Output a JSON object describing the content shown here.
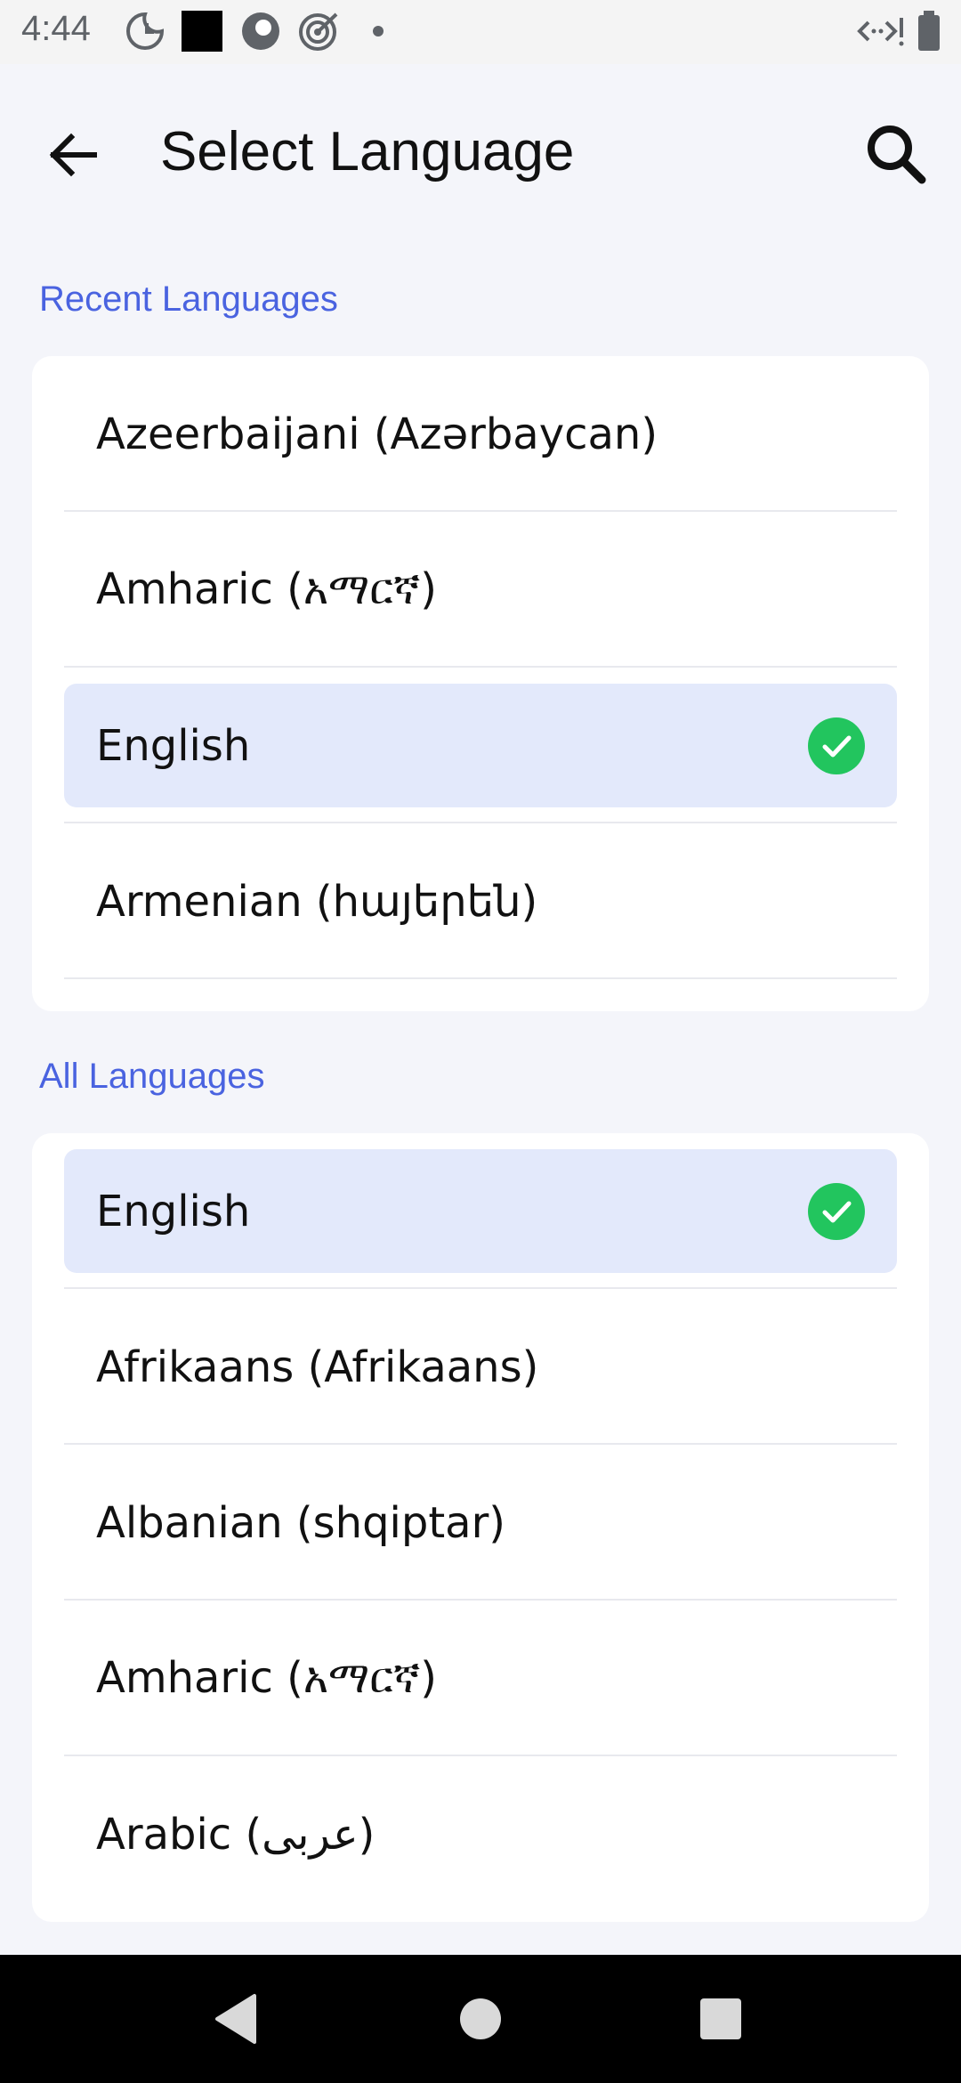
{
  "status_bar": {
    "time": "4:44"
  },
  "header": {
    "title": "Select Language",
    "back_icon": "arrow-left-icon",
    "search_icon": "search-icon"
  },
  "colors": {
    "accent": "#4a63e0",
    "selected_bg": "#e3e9fb",
    "check": "#22c55e"
  },
  "recent": {
    "title": "Recent Languages",
    "items": [
      {
        "label": "Azeerbaijani (Azərbaycan)",
        "selected": false
      },
      {
        "label": "Amharic (አማርኛ)",
        "selected": false
      },
      {
        "label": "English",
        "selected": true
      },
      {
        "label": "Armenian (հայերեն)",
        "selected": false
      }
    ]
  },
  "all": {
    "title": "All Languages",
    "items": [
      {
        "label": "English",
        "selected": true
      },
      {
        "label": "Afrikaans (Afrikaans)",
        "selected": false
      },
      {
        "label": "Albanian (shqiptar)",
        "selected": false
      },
      {
        "label": "Amharic (አማርኛ)",
        "selected": false
      },
      {
        "label": "Arabic (عربى)",
        "selected": false
      }
    ]
  }
}
